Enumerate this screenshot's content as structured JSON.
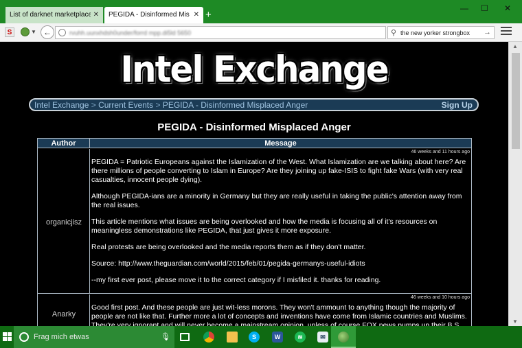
{
  "browser": {
    "tabs": [
      {
        "label": "List of darknet marketplaces & ...",
        "active": false
      },
      {
        "label": "PEGIDA - Disinformed Misplac...",
        "active": true
      }
    ],
    "url": "rvuhh.uunxhdsh0under/forrd mpp.di5ld   5650",
    "search_value": "the new yorker strongbox",
    "accent_color": "#1e8a25"
  },
  "site": {
    "logo_text": "Intel Exchange",
    "breadcrumb": [
      {
        "label": "Intel Exchange"
      },
      {
        "label": "Current Events"
      },
      {
        "label": "PEGIDA - Disinformed Misplaced Anger"
      }
    ],
    "breadcrumb_separator": ">",
    "signup_label": "Sign Up",
    "topic_title": "PEGIDA - Disinformed Misplaced Anger",
    "columns": {
      "author": "Author",
      "message": "Message"
    },
    "posts": [
      {
        "author": "organicjisz",
        "timestamp": "46 weeks and 11 hours ago",
        "paragraphs": [
          "PEGIDA = Patriotic Europeans against the Islamization of the West. What Islamization are we talking about here? Are there millions of people converting to Islam in Europe? Are they joining up fake-ISIS to fight fake Wars (with very real casualties, innocent people dying).",
          "Although PEGIDA-ians are a minority in Germany but they are really useful in taking the public's attention away from the real issues.",
          "This article mentions what issues are being overlooked and how the media is focusing all of it's resources on meaningless demonstrations like PEGIDA, that just gives it more exposure.",
          "Real protests are being overlooked and the media reports them as if they don't matter.",
          "Source: http://www.theguardian.com/world/2015/feb/01/pegida-germanys-useful-idiots",
          "--my first ever post, please move it to the correct category if I misfiled it. thanks for reading."
        ]
      },
      {
        "author": "Anarky",
        "timestamp": "46 weeks and 10 hours ago",
        "paragraphs": [
          "Good first post. And these people are just wit-less morons. They won't ammount to anything though the majority of people are not like that. Further more a lot of concepts and inventions have come from Islamic countries and Muslims. They're very ignorant and will never become a mainstream opinion, unless of course FOX news pumps up their B.S."
        ]
      }
    ]
  },
  "taskbar": {
    "search_placeholder": "Frag mich etwas",
    "apps": [
      "task-view-icon",
      "chrome-icon",
      "file-explorer-icon",
      "skype-icon",
      "word-icon",
      "spotify-icon",
      "mail-icon",
      "tor-browser-icon"
    ]
  }
}
